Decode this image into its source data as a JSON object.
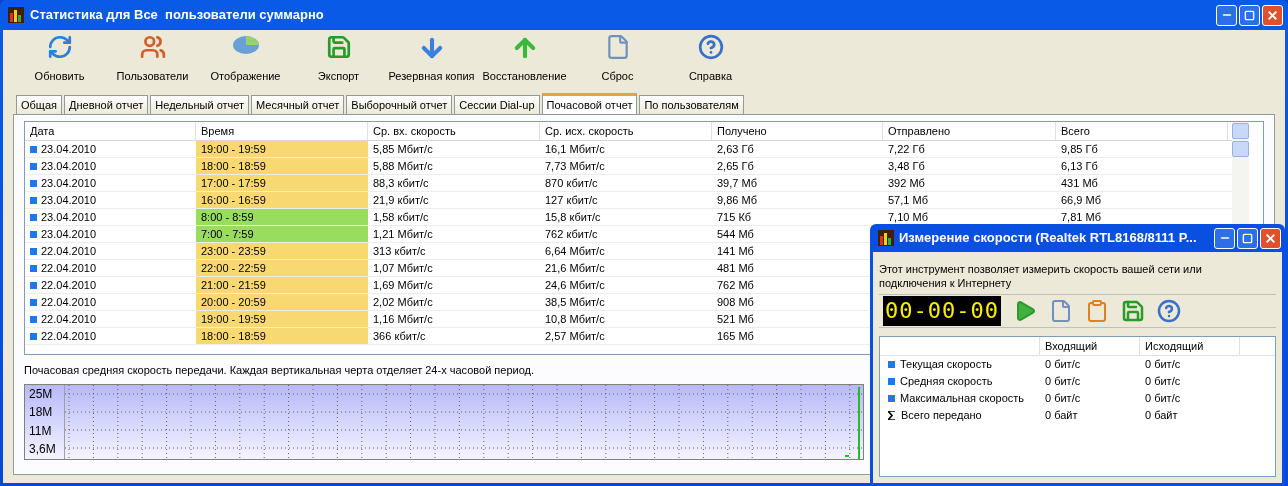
{
  "window": {
    "title": "Статистика для Все  пользователи суммарно"
  },
  "toolbar": [
    "Обновить",
    "Пользователи",
    "Отображение",
    "Экспорт",
    "Резервная копия",
    "Восстановление",
    "Сброс",
    "Справка"
  ],
  "tabs": [
    {
      "label": "Общая",
      "selected": false
    },
    {
      "label": "Дневной отчет",
      "selected": false
    },
    {
      "label": "Недельный отчет",
      "selected": false
    },
    {
      "label": "Месячный отчет",
      "selected": false
    },
    {
      "label": "Выборочный отчет",
      "selected": false
    },
    {
      "label": "Сессии Dial-up",
      "selected": false
    },
    {
      "label": "Почасовой отчет",
      "selected": true
    },
    {
      "label": "По пользователям",
      "selected": false
    }
  ],
  "table": {
    "columns": [
      "Дата",
      "Время",
      "Ср. вх. скорость",
      "Ср. исх. скорость",
      "Получено",
      "Отправлено",
      "Всего"
    ],
    "rows": [
      {
        "color": "#f8d870",
        "cells": [
          "23.04.2010",
          "19:00 - 19:59",
          "5,85 Мбит/с",
          "16,1 Мбит/с",
          "2,63 Гб",
          "7,22 Гб",
          "9,85 Гб"
        ]
      },
      {
        "color": "#f8d870",
        "cells": [
          "23.04.2010",
          "18:00 - 18:59",
          "5,88 Мбит/с",
          "7,73 Мбит/с",
          "2,65 Гб",
          "3,48 Гб",
          "6,13 Гб"
        ]
      },
      {
        "color": "#f8d870",
        "cells": [
          "23.04.2010",
          "17:00 - 17:59",
          "88,3 кбит/с",
          "870 кбит/с",
          "39,7 Мб",
          "392 Мб",
          "431 Мб"
        ]
      },
      {
        "color": "#f8d870",
        "cells": [
          "23.04.2010",
          "16:00 - 16:59",
          "21,9 кбит/с",
          "127 кбит/с",
          "9,86 Мб",
          "57,1 Мб",
          "66,9 Мб"
        ]
      },
      {
        "color": "#98dc60",
        "cells": [
          "23.04.2010",
          "8:00 - 8:59",
          "1,58 кбит/с",
          "15,8 кбит/с",
          "715 Кб",
          "7,10 Мб",
          "7,81 Мб"
        ]
      },
      {
        "color": "#98dc60",
        "cells": [
          "23.04.2010",
          "7:00 - 7:59",
          "1,21 Мбит/с",
          "762 кбит/с",
          "544 Мб"
        ]
      },
      {
        "color": "#f8d870",
        "cells": [
          "22.04.2010",
          "23:00 - 23:59",
          "313 кбит/с",
          "6,64 Мбит/с",
          "141 Мб"
        ]
      },
      {
        "color": "#f8d870",
        "cells": [
          "22.04.2010",
          "22:00 - 22:59",
          "1,07 Мбит/с",
          "21,6 Мбит/с",
          "481 Мб"
        ]
      },
      {
        "color": "#f8d870",
        "cells": [
          "22.04.2010",
          "21:00 - 21:59",
          "1,69 Мбит/с",
          "24,6 Мбит/с",
          "762 Мб"
        ]
      },
      {
        "color": "#f8d870",
        "cells": [
          "22.04.2010",
          "20:00 - 20:59",
          "2,02 Мбит/с",
          "38,5 Мбит/с",
          "908 Мб"
        ]
      },
      {
        "color": "#f8d870",
        "cells": [
          "22.04.2010",
          "19:00 - 19:59",
          "1,16 Мбит/с",
          "10,8 Мбит/с",
          "521 Мб"
        ]
      },
      {
        "color": "#f8d870",
        "cells": [
          "22.04.2010",
          "18:00 - 18:59",
          "366 кбит/с",
          "2,57 Мбит/с",
          "165 Мб"
        ]
      }
    ]
  },
  "chart": {
    "caption": "Почасовая средняя скорость передачи. Каждая вертикальная черта отделяет 24-х часовой период.",
    "y_labels": [
      "25M",
      "18M",
      "11M",
      "3,6M"
    ]
  },
  "speed_window": {
    "title": "Измерение скорости (Realtek RTL8168/8111 P...",
    "description": "Этот инструмент позволяет измерить скорость вашей сети или подключения к Интернету",
    "timer": "00-00-00",
    "columns": [
      "Входящий",
      "Исходящий"
    ],
    "rows": [
      {
        "kind": "square",
        "label": "Текущая скорость",
        "in": "0 бит/с",
        "out": "0 бит/с"
      },
      {
        "kind": "square",
        "label": "Средняя скорость",
        "in": "0 бит/с",
        "out": "0 бит/с"
      },
      {
        "kind": "square",
        "label": "Максимальная скорость",
        "in": "0 бит/с",
        "out": "0 бит/с"
      },
      {
        "kind": "sum",
        "label": "Всего передано",
        "in": "0 байт",
        "out": "0 байт"
      }
    ]
  }
}
